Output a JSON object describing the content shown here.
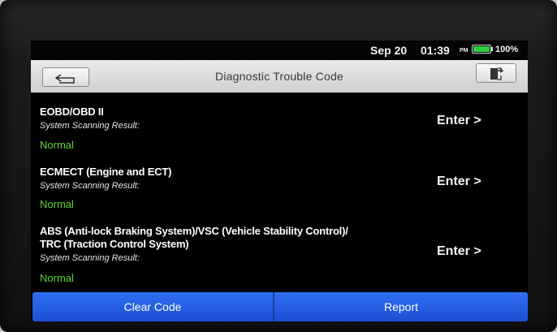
{
  "status_bar": {
    "date": "Sep 20",
    "time": "01:39",
    "ampm": "PM",
    "battery_text": "100%",
    "battery_level": 1.0,
    "battery_color": "#2ecc40"
  },
  "header": {
    "title": "Diagnostic Trouble Code",
    "back_icon": "back-arrow-icon",
    "exit_icon": "exit-door-icon"
  },
  "systems": [
    {
      "title_lines": [
        "EOBD/OBD II"
      ],
      "subtitle": "System Scanning Result:",
      "status": "Normal",
      "action": "Enter >"
    },
    {
      "title_lines": [
        "ECMECT (Engine and ECT)"
      ],
      "subtitle": "System Scanning Result:",
      "status": "Normal",
      "action": "Enter >"
    },
    {
      "title_lines": [
        "ABS (Anti-lock Braking System)/VSC (Vehicle Stability Control)/",
        "TRC (Traction Control System)"
      ],
      "subtitle": "System Scanning Result:",
      "status": "Normal",
      "action": "Enter >"
    }
  ],
  "buttons": {
    "clear_code": "Clear Code",
    "report": "Report"
  },
  "colors": {
    "status_normal": "#5cd634",
    "button_blue": "#2f6ff2"
  }
}
